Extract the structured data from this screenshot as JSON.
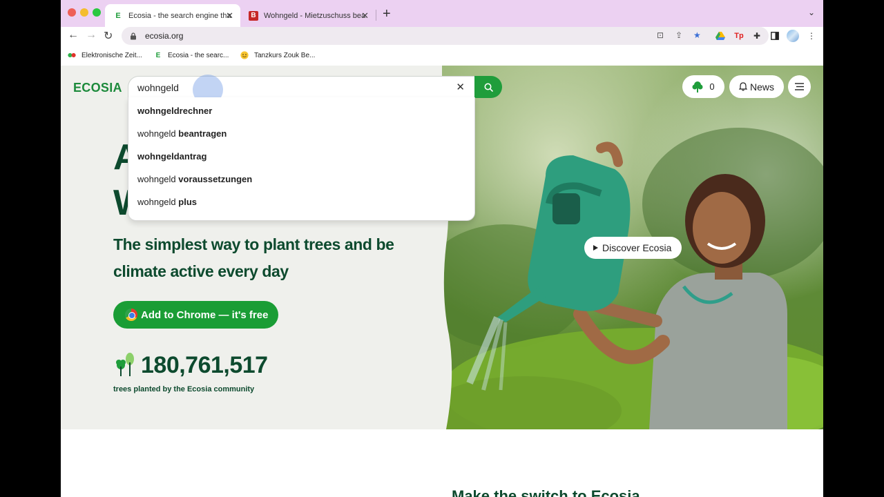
{
  "browser": {
    "tabs": [
      {
        "title": "Ecosia - the search engine tha",
        "favicon": "E",
        "active": true
      },
      {
        "title": "Wohngeld - Mietzuschuss bea",
        "favicon": "B",
        "active": false
      }
    ],
    "url": "ecosia.org",
    "bookmarks": [
      {
        "label": "Elektronische Zeit..."
      },
      {
        "label": "Ecosia - the searc..."
      },
      {
        "label": "Tanzkurs Zouk Be..."
      }
    ]
  },
  "ecosia": {
    "logo": "ECOSIA",
    "search": {
      "query": "wohngeld"
    },
    "suggestions": [
      {
        "prefix": "",
        "bold": "wohngeldrechner"
      },
      {
        "prefix": "wohngeld ",
        "bold": "beantragen"
      },
      {
        "prefix": "",
        "bold": "wohngeldantrag"
      },
      {
        "prefix": "wohngeld ",
        "bold": "voraussetzungen"
      },
      {
        "prefix": "wohngeld ",
        "bold": "plus"
      }
    ],
    "heading_partial": [
      "A",
      "W"
    ],
    "tagline": "The simplest way to plant trees and be climate active every day",
    "cta": "Add to Chrome — it's free",
    "tree_count": "180,761,517",
    "tree_count_caption": "trees planted by the Ecosia community",
    "tree_badge_count": "0",
    "news_label": "News",
    "discover_label": "Discover Ecosia",
    "below_fold_heading": "Make the switch to Ecosia"
  },
  "colors": {
    "brand_green": "#1f9d3b",
    "dark_green": "#0d4a2e",
    "tab_strip": "#ecd1f2"
  }
}
